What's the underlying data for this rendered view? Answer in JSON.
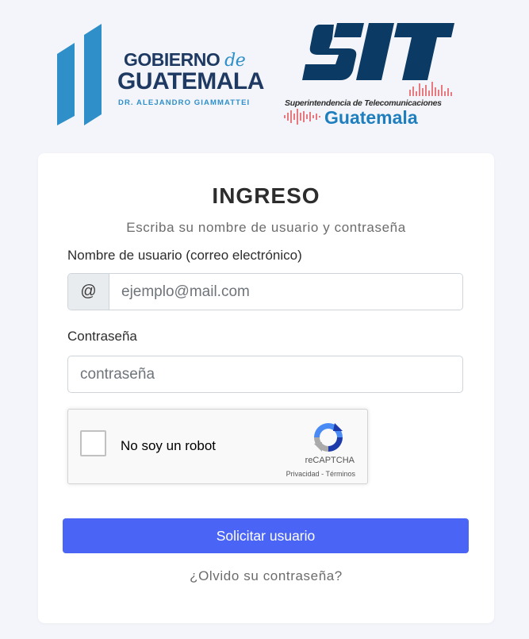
{
  "header": {
    "gobierno": {
      "line1": "GOBIERNO",
      "line1_de": "de",
      "line2": "GUATEMALA",
      "sub": "DR. ALEJANDRO GIAMMATTEI"
    },
    "sit": {
      "acronym": "SIT",
      "sub": "Superintendencia de Telecomunicaciones",
      "country": "Guatemala"
    }
  },
  "login": {
    "title": "INGRESO",
    "subtitle": "Escriba su nombre de usuario y contraseña",
    "username": {
      "label": "Nombre de usuario (correo electrónico)",
      "addon": "@",
      "placeholder": "ejemplo@mail.com",
      "value": ""
    },
    "password": {
      "label": "Contraseña",
      "placeholder": "contraseña",
      "value": ""
    },
    "recaptcha": {
      "label": "No soy un robot",
      "brand": "reCAPTCHA",
      "privacy": "Privacidad",
      "separator": " - ",
      "terms": "Términos"
    },
    "submit_label": "Solicitar usuario",
    "forgot_link": "¿Olvido su contraseña?"
  },
  "colors": {
    "background": "#f4f5fa",
    "primary_button": "#4a65f5",
    "gob_navy": "#1e3a63",
    "gob_blue": "#2e8fc9",
    "sit_navy": "#0b3a64",
    "sit_blue": "#1f7fbe",
    "sit_red": "#e0444a"
  },
  "icons": {
    "gob_logo": "guatemala-flag-stripes-icon",
    "sit_logo": "sit-logo-icon",
    "recaptcha_logo": "recaptcha-icon"
  }
}
